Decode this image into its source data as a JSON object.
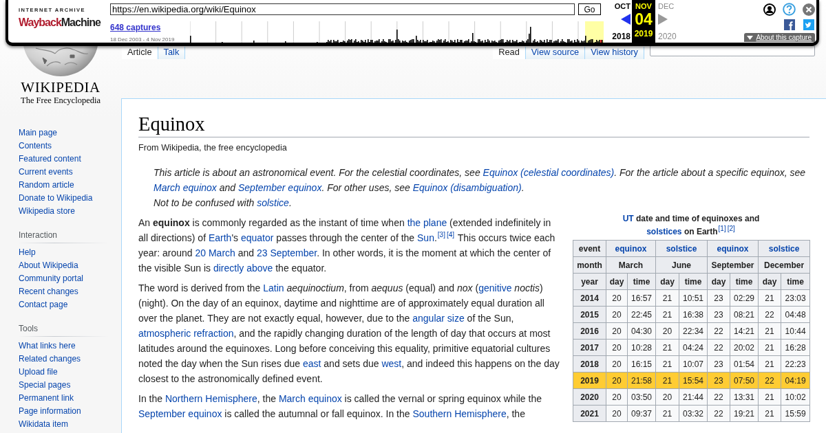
{
  "wayback": {
    "caption": "INTERNET ARCHIVE",
    "wordmark": [
      "Wayback",
      "Machine"
    ],
    "url": "https://en.wikipedia.org/wiki/Equinox",
    "go": "Go",
    "captures": "648 captures",
    "range": "18 Dec 2003 - 4 Nov 2019",
    "months": [
      {
        "month": "OCT",
        "year": "2018",
        "selected": false,
        "disabled": false
      },
      {
        "month": "NOV",
        "day": "04",
        "year": "2019",
        "selected": true,
        "disabled": false
      },
      {
        "month": "DEC",
        "year": "2020",
        "selected": false,
        "disabled": true
      }
    ],
    "about": "About this capture"
  },
  "logo": {
    "wordmark": "WIKIPEDIA",
    "tagline": "The Free Encyclopedia"
  },
  "sidebar": {
    "nav": [
      "Main page",
      "Contents",
      "Featured content",
      "Current events",
      "Random article",
      "Donate to Wikipedia",
      "Wikipedia store"
    ],
    "sections": [
      {
        "heading": "Interaction",
        "items": [
          "Help",
          "About Wikipedia",
          "Community portal",
          "Recent changes",
          "Contact page"
        ]
      },
      {
        "heading": "Tools",
        "items": [
          "What links here",
          "Related changes",
          "Upload file",
          "Special pages",
          "Permanent link",
          "Page information",
          "Wikidata item"
        ]
      }
    ]
  },
  "tabs_left": [
    {
      "label": "Article",
      "selected": true
    },
    {
      "label": "Talk",
      "selected": false
    }
  ],
  "tabs_right": [
    {
      "label": "Read",
      "selected": true
    },
    {
      "label": "View source",
      "selected": false
    },
    {
      "label": "View history",
      "selected": false
    }
  ],
  "article": {
    "title": "Equinox",
    "subtitle": "From Wikipedia, the free encyclopedia",
    "hatnotes": [
      [
        {
          "kind": "text",
          "text": "This article is about an astronomical event. For the celestial coordinates, see "
        },
        {
          "kind": "link",
          "text": "Equinox (celestial coordinates)"
        },
        {
          "kind": "text",
          "text": ". For the article about a specific equinox, see "
        },
        {
          "kind": "link",
          "text": "March equinox"
        },
        {
          "kind": "text",
          "text": " and "
        },
        {
          "kind": "link",
          "text": "September equinox"
        },
        {
          "kind": "text",
          "text": ". For other uses, see "
        },
        {
          "kind": "link",
          "text": "Equinox (disambiguation)"
        },
        {
          "kind": "text",
          "text": "."
        }
      ],
      [
        {
          "kind": "text",
          "text": "Not to be confused with "
        },
        {
          "kind": "link",
          "text": "solstice"
        },
        {
          "kind": "text",
          "text": "."
        }
      ]
    ],
    "paragraphs": [
      [
        {
          "kind": "text",
          "text": "An **equinox** is commonly regarded as the instant of time when "
        },
        {
          "kind": "link",
          "text": "the plane"
        },
        {
          "kind": "text",
          "text": " (extended indefinitely in all directions) of "
        },
        {
          "kind": "link",
          "text": "Earth"
        },
        {
          "kind": "text",
          "text": "'s "
        },
        {
          "kind": "link",
          "text": "equator"
        },
        {
          "kind": "text",
          "text": " passes through the center of the "
        },
        {
          "kind": "link",
          "text": "Sun"
        },
        {
          "kind": "text",
          "text": "."
        },
        {
          "kind": "ref",
          "text": "[3]"
        },
        {
          "kind": "ref",
          "text": "[4]"
        },
        {
          "kind": "text",
          "text": " This occurs twice each year: around "
        },
        {
          "kind": "link",
          "text": "20 March"
        },
        {
          "kind": "text",
          "text": " and "
        },
        {
          "kind": "link",
          "text": "23 September"
        },
        {
          "kind": "text",
          "text": ". In other words, it is the moment at which the center of the visible Sun is "
        },
        {
          "kind": "link",
          "text": "directly above"
        },
        {
          "kind": "text",
          "text": " the equator."
        }
      ],
      [
        {
          "kind": "text",
          "text": "The word is derived from the "
        },
        {
          "kind": "link",
          "text": "Latin"
        },
        {
          "kind": "text",
          "text": " *aequinoctium*, from *aequus* (equal) and *nox* ("
        },
        {
          "kind": "link",
          "text": "genitive"
        },
        {
          "kind": "text",
          "text": " *noctis*) (night). On the day of an equinox, daytime and nighttime are of approximately equal duration all over the planet. They are not exactly equal, however, due to the "
        },
        {
          "kind": "link",
          "text": "angular size"
        },
        {
          "kind": "text",
          "text": " of the Sun, "
        },
        {
          "kind": "link",
          "text": "atmospheric refraction"
        },
        {
          "kind": "text",
          "text": ", and the rapidly changing duration of the length of day that occurs at most latitudes around the equinoxes. Long before conceiving this equality, primitive equatorial cultures noted the day when the Sun rises due "
        },
        {
          "kind": "link",
          "text": "east"
        },
        {
          "kind": "text",
          "text": " and sets due "
        },
        {
          "kind": "link",
          "text": "west"
        },
        {
          "kind": "text",
          "text": ", and indeed this happens on the day closest to the astronomically defined event."
        }
      ],
      [
        {
          "kind": "text",
          "text": "In the "
        },
        {
          "kind": "link",
          "text": "Northern Hemisphere"
        },
        {
          "kind": "text",
          "text": ", the "
        },
        {
          "kind": "link",
          "text": "March equinox"
        },
        {
          "kind": "text",
          "text": " is called the vernal or spring equinox while the "
        },
        {
          "kind": "link",
          "text": "September equinox"
        },
        {
          "kind": "text",
          "text": " is called the autumnal or fall equinox. In the "
        },
        {
          "kind": "link",
          "text": "Southern Hemisphere"
        },
        {
          "kind": "text",
          "text": ", the"
        }
      ]
    ]
  },
  "table": {
    "caption": [
      {
        "kind": "link",
        "text": "UT"
      },
      {
        "kind": "text",
        "text": " date and time of equinoxes and "
      },
      {
        "kind": "link",
        "text": "solstices"
      },
      {
        "kind": "text",
        "text": " on Earth"
      },
      {
        "kind": "ref",
        "text": "[1]"
      },
      {
        "kind": "ref",
        "text": "[2]"
      }
    ],
    "event_row": [
      "event",
      "equinox",
      "solstice",
      "equinox",
      "solstice"
    ],
    "month_row": [
      "month",
      "March",
      "June",
      "September",
      "December"
    ],
    "unit_row": [
      "year",
      "day",
      "time",
      "day",
      "time",
      "day",
      "time",
      "day",
      "time"
    ],
    "rows": [
      {
        "cells": [
          "2014",
          "20",
          "16:57",
          "21",
          "10:51",
          "23",
          "02:29",
          "21",
          "23:03"
        ],
        "highlighted": false
      },
      {
        "cells": [
          "2015",
          "20",
          "22:45",
          "21",
          "16:38",
          "23",
          "08:21",
          "22",
          "04:48"
        ],
        "highlighted": false
      },
      {
        "cells": [
          "2016",
          "20",
          "04:30",
          "20",
          "22:34",
          "22",
          "14:21",
          "21",
          "10:44"
        ],
        "highlighted": false
      },
      {
        "cells": [
          "2017",
          "20",
          "10:28",
          "21",
          "04:24",
          "22",
          "20:02",
          "21",
          "16:28"
        ],
        "highlighted": false
      },
      {
        "cells": [
          "2018",
          "20",
          "16:15",
          "21",
          "10:07",
          "23",
          "01:54",
          "21",
          "22:23"
        ],
        "highlighted": false
      },
      {
        "cells": [
          "2019",
          "20",
          "21:58",
          "21",
          "15:54",
          "23",
          "07:50",
          "22",
          "04:19"
        ],
        "highlighted": true
      },
      {
        "cells": [
          "2020",
          "20",
          "03:50",
          "20",
          "21:44",
          "22",
          "13:31",
          "21",
          "10:02"
        ],
        "highlighted": false
      },
      {
        "cells": [
          "2021",
          "20",
          "09:37",
          "21",
          "03:32",
          "22",
          "19:21",
          "21",
          "15:59"
        ],
        "highlighted": false
      }
    ]
  }
}
